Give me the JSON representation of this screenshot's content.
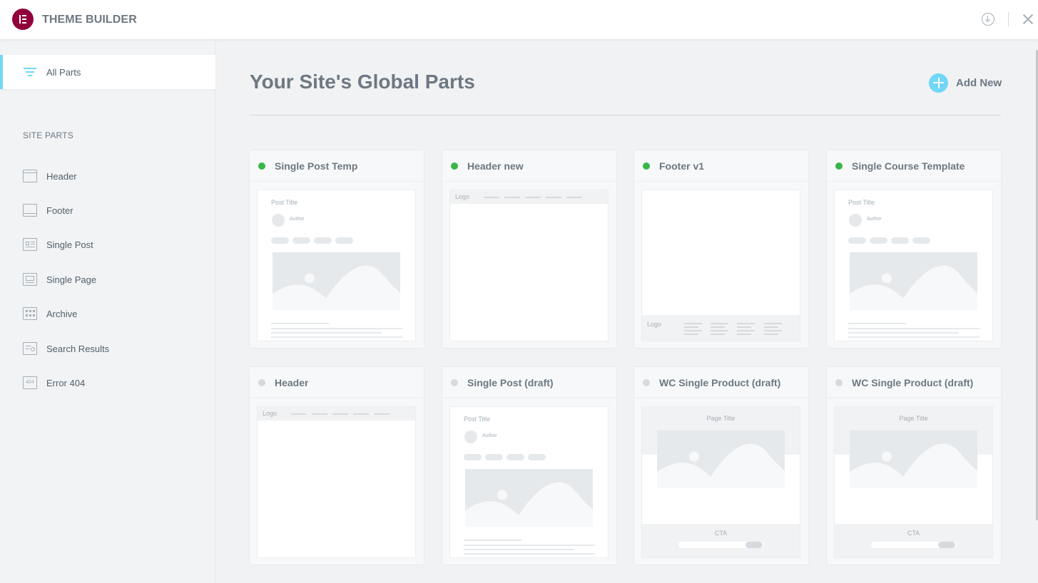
{
  "app": {
    "title": "THEME BUILDER"
  },
  "sidebar": {
    "all_parts_label": "All Parts",
    "section_title": "SITE PARTS",
    "items": [
      {
        "label": "Header",
        "icon": "header-icon"
      },
      {
        "label": "Footer",
        "icon": "footer-icon"
      },
      {
        "label": "Single Post",
        "icon": "single-post-icon"
      },
      {
        "label": "Single Page",
        "icon": "single-page-icon"
      },
      {
        "label": "Archive",
        "icon": "archive-icon"
      },
      {
        "label": "Search Results",
        "icon": "search-results-icon"
      },
      {
        "label": "Error 404",
        "icon": "error-404-icon",
        "icon_text": "404"
      }
    ]
  },
  "main": {
    "title": "Your Site's Global Parts",
    "add_new_label": "Add New",
    "cards": [
      {
        "title": "Single Post Temp",
        "status": "active",
        "preview": "post",
        "pv_title": "Post Title",
        "pv_author": "Author"
      },
      {
        "title": "Header new",
        "status": "active",
        "preview": "header",
        "pv_logo": "Logo"
      },
      {
        "title": "Footer v1",
        "status": "active",
        "preview": "footer",
        "pv_logo": "Logo"
      },
      {
        "title": "Single Course Template",
        "status": "active",
        "preview": "post",
        "pv_title": "Post Title",
        "pv_author": "Author"
      },
      {
        "title": "Header",
        "status": "draft",
        "preview": "header",
        "pv_logo": "Logo"
      },
      {
        "title": "Single Post (draft)",
        "status": "draft",
        "preview": "post",
        "pv_title": "Post Title",
        "pv_author": "Author"
      },
      {
        "title": "WC Single Product (draft)",
        "status": "draft",
        "preview": "product",
        "pv_title": "Page Title",
        "pv_cta": "CTA"
      },
      {
        "title": "WC Single Product (draft)",
        "status": "draft",
        "preview": "product",
        "pv_title": "Page Title",
        "pv_cta": "CTA"
      }
    ]
  },
  "colors": {
    "brand": "#92003b",
    "accent": "#71d7f7",
    "active": "#39b54a",
    "draft": "#d5dadf"
  }
}
